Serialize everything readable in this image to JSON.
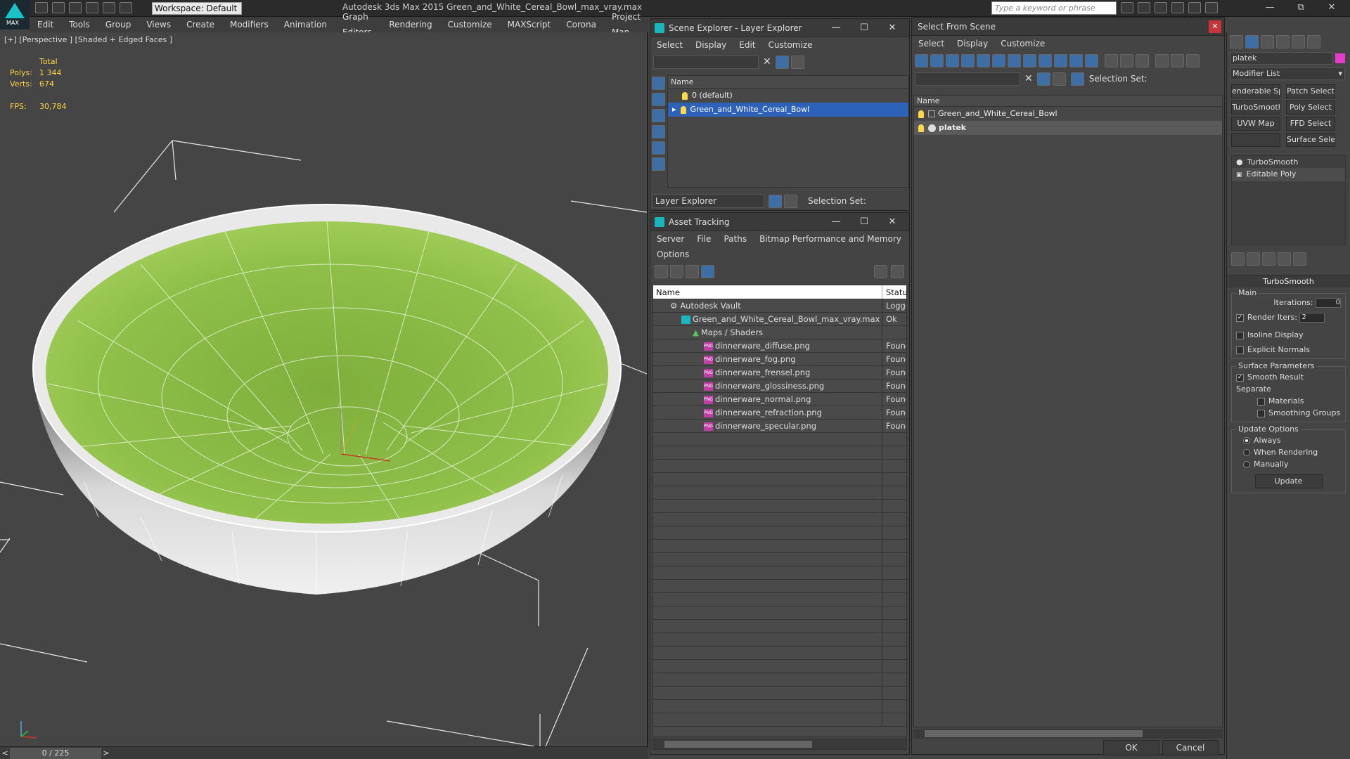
{
  "colors": {
    "accent": "#2d62b8",
    "bowl_inner": "#8fc04a",
    "bulb": "#ffd94a",
    "app_cyan": "#19c3c8",
    "png_magenta": "#c13ea7",
    "stats_yellow": "#ffd24a"
  },
  "app": {
    "logo_text": "MAX",
    "workspace": "Workspace: Default",
    "title": "Autodesk 3ds Max  2015     Green_and_White_Cereal_Bowl_max_vray.max",
    "search_placeholder": "Type a keyword or phrase",
    "menu": [
      "Edit",
      "Tools",
      "Group",
      "Views",
      "Create",
      "Modifiers",
      "Animation",
      "Graph Editors",
      "Rendering",
      "Customize",
      "MAXScript",
      "Corona",
      "Project Man"
    ]
  },
  "viewport": {
    "label": "[+] [Perspective ] [Shaded + Edged Faces ]",
    "stats": {
      "total_label": "Total",
      "polys_label": "Polys:",
      "polys": "1 344",
      "verts_label": "Verts:",
      "verts": "674",
      "fps_label": "FPS:",
      "fps": "30,784"
    },
    "axis": {
      "z": "z"
    },
    "timeline": {
      "frame": "0 / 225",
      "prev": "<",
      "next": ">"
    }
  },
  "scene_explorer": {
    "title": "Scene Explorer - Layer Explorer",
    "menu": [
      "Select",
      "Display",
      "Edit",
      "Customize"
    ],
    "column": "Name",
    "rows": [
      {
        "label": "0 (default)"
      },
      {
        "label": "Green_and_White_Cereal_Bowl"
      }
    ],
    "footer_dropdown": "Layer Explorer",
    "selection_set": "Selection Set:"
  },
  "asset_tracking": {
    "title": "Asset Tracking",
    "menu": [
      "Server",
      "File",
      "Paths",
      "Bitmap Performance and Memory"
    ],
    "menu2": "Options",
    "columns": [
      "Name",
      "Status"
    ],
    "rows": [
      {
        "name": "Autodesk Vault",
        "status": "Logged"
      },
      {
        "name": "Green_and_White_Cereal_Bowl_max_vray.max",
        "status": "Ok"
      },
      {
        "name": "Maps / Shaders",
        "status": ""
      },
      {
        "name": "dinnerware_diffuse.png",
        "status": "Found"
      },
      {
        "name": "dinnerware_fog.png",
        "status": "Found"
      },
      {
        "name": "dinnerware_frensel.png",
        "status": "Found"
      },
      {
        "name": "dinnerware_glossiness.png",
        "status": "Found"
      },
      {
        "name": "dinnerware_normal.png",
        "status": "Found"
      },
      {
        "name": "dinnerware_refraction.png",
        "status": "Found"
      },
      {
        "name": "dinnerware_specular.png",
        "status": "Found"
      }
    ],
    "png_icon": "PNG"
  },
  "select_from_scene": {
    "title": "Select From Scene",
    "menu": [
      "Select",
      "Display",
      "Customize"
    ],
    "selection_set": "Selection Set:",
    "column": "Name",
    "rows": [
      {
        "label": "Green_and_White_Cereal_Bowl"
      },
      {
        "label": "platek"
      }
    ],
    "ok": "OK",
    "cancel": "Cancel"
  },
  "command_panel": {
    "object_name": "platek",
    "modifier_list": "Modifier List",
    "modifier_buttons": [
      "enderable Spli",
      "Patch Select",
      "TurboSmooth",
      "Poly Select",
      "UVW Map",
      "FFD Select",
      "",
      "Surface Select"
    ],
    "stack": [
      "TurboSmooth",
      "Editable Poly"
    ],
    "rollout": "TurboSmooth",
    "main_label": "Main",
    "iterations_label": "Iterations:",
    "iterations": "0",
    "render_iters_label": "Render Iters:",
    "render_iters": "2",
    "isoline": "Isoline Display",
    "explicit_normals": "Explicit Normals",
    "surface_params": "Surface Parameters",
    "smooth_result": "Smooth Result",
    "separate": "Separate",
    "materials": "Materials",
    "smoothing_groups": "Smoothing Groups",
    "update_options": "Update Options",
    "always": "Always",
    "when_rendering": "When Rendering",
    "manually": "Manually",
    "update": "Update"
  }
}
